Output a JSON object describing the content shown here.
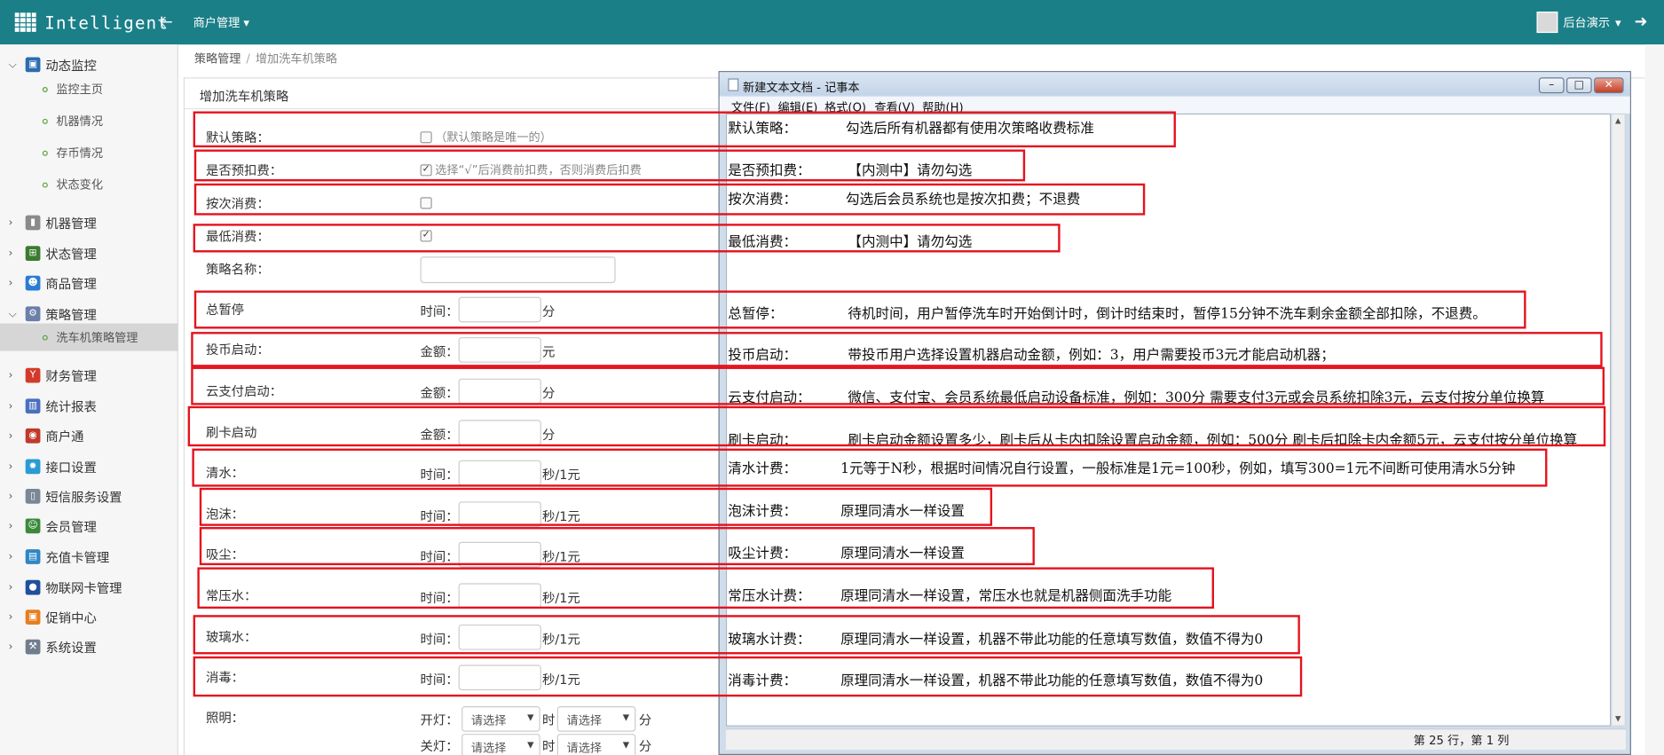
{
  "app": {
    "brand": "Intelligent",
    "top_menu": "商户管理",
    "user": "后台演示"
  },
  "sidebar": {
    "items": [
      {
        "label": "动态监控",
        "expanded": true,
        "icon": "monitor-icon"
      },
      {
        "label": "机器管理",
        "icon": "machine-icon"
      },
      {
        "label": "状态管理",
        "icon": "sitemap-icon"
      },
      {
        "label": "商品管理",
        "icon": "goods-icon"
      },
      {
        "label": "策略管理",
        "expanded": true,
        "icon": "wrench-icon"
      },
      {
        "label": "财务管理",
        "icon": "finance-icon"
      },
      {
        "label": "统计报表",
        "icon": "chart-icon"
      },
      {
        "label": "商户通",
        "icon": "merchant-icon"
      },
      {
        "label": "接口设置",
        "icon": "gear-icon"
      },
      {
        "label": "短信服务设置",
        "icon": "phone-icon"
      },
      {
        "label": "会员管理",
        "icon": "members-icon"
      },
      {
        "label": "充值卡管理",
        "icon": "card-icon"
      },
      {
        "label": "物联网卡管理",
        "icon": "iot-icon"
      },
      {
        "label": "促销中心",
        "icon": "promo-icon"
      },
      {
        "label": "系统设置",
        "icon": "tools-icon"
      }
    ],
    "monitor_sub": [
      "监控主页",
      "机器情况",
      "存币情况",
      "状态变化"
    ],
    "strategy_sub": [
      "洗车机策略管理"
    ]
  },
  "breadcrumb": {
    "parent": "策略管理",
    "current": "增加洗车机策略"
  },
  "panel": {
    "title": "增加洗车机策略"
  },
  "form": {
    "default_label": "默认策略：",
    "default_hint": "（默认策略是唯一的）",
    "prepay_label": "是否预扣费：",
    "prepay_hint": "选择“√”后消费前扣费，否则消费后扣费",
    "per_label": "按次消费：",
    "min_label": "最低消费：",
    "name_label": "策略名称：",
    "pause_label": "总暂停",
    "coin_label": "投币启动：",
    "cloud_label": "云支付启动：",
    "card_label": "刷卡启动",
    "clear_label": "清水：",
    "foam_label": "泡沫：",
    "vacuum_label": "吸尘：",
    "hp_label": "常压水：",
    "glass_label": "玻璃水：",
    "disinfect_label": "消毒：",
    "light_label": "照明：",
    "time_label": "时间：",
    "amount_label": "金额：",
    "unit_min": "分",
    "unit_yuan": "元",
    "unit_sec": "秒/1元",
    "on_label": "开灯：",
    "off_label": "关灯：",
    "select_placeholder": "请选择",
    "hour": "时",
    "minute": "分"
  },
  "notepad": {
    "title": "新建文本文档 - 记事本",
    "menu": [
      "文件(F)",
      "编辑(E)",
      "格式(O)",
      "查看(V)",
      "帮助(H)"
    ],
    "lines": [
      {
        "k": "默认策略：",
        "v": "勾选后所有机器都有使用次策略收费标准"
      },
      {
        "k": "是否预扣费：",
        "v": "【内测中】请勿勾选"
      },
      {
        "k": "按次消费：",
        "v": "勾选后会员系统也是按次扣费；不退费"
      },
      {
        "k": "最低消费：",
        "v": "【内测中】请勿勾选"
      },
      {
        "k": "总暂停：",
        "v": "待机时间，用户暂停洗车时开始倒计时，倒计时结束时，暂停15分钟不洗车剩余金额全部扣除，不退费。"
      },
      {
        "k": "投币启动：",
        "v": "带投币用户选择设置机器启动金额，例如：3，用户需要投币3元才能启动机器；"
      },
      {
        "k": "云支付启动：",
        "v": "微信、支付宝、会员系统最低启动设备标准，例如：300分 需要支付3元或会员系统扣除3元，云支付按分单位换算"
      },
      {
        "k": "刷卡启动：",
        "v": "刷卡启动金额设置多少，刷卡后从卡内扣除设置启动金额，例如：500分 刷卡后扣除卡内金额5元，云支付按分单位换算"
      },
      {
        "k": "清水计费：",
        "v": "1元等于N秒，根据时间情况自行设置，一般标准是1元=100秒，例如，填写300=1元不间断可使用清水5分钟"
      },
      {
        "k": "泡沫计费：",
        "v": "原理同清水一样设置"
      },
      {
        "k": "吸尘计费：",
        "v": "原理同清水一样设置"
      },
      {
        "k": "常压水计费：",
        "v": "原理同清水一样设置，常压水也就是机器侧面洗手功能"
      },
      {
        "k": "玻璃水计费：",
        "v": "原理同清水一样设置，机器不带此功能的任意填写数值，数值不得为0"
      },
      {
        "k": "消毒计费：",
        "v": "原理同清水一样设置，机器不带此功能的任意填写数值，数值不得为0"
      }
    ],
    "status": "第 25 行，第 1 列"
  },
  "colors": {
    "topbar": "#1b7f88",
    "annotation": "#e4121d"
  }
}
